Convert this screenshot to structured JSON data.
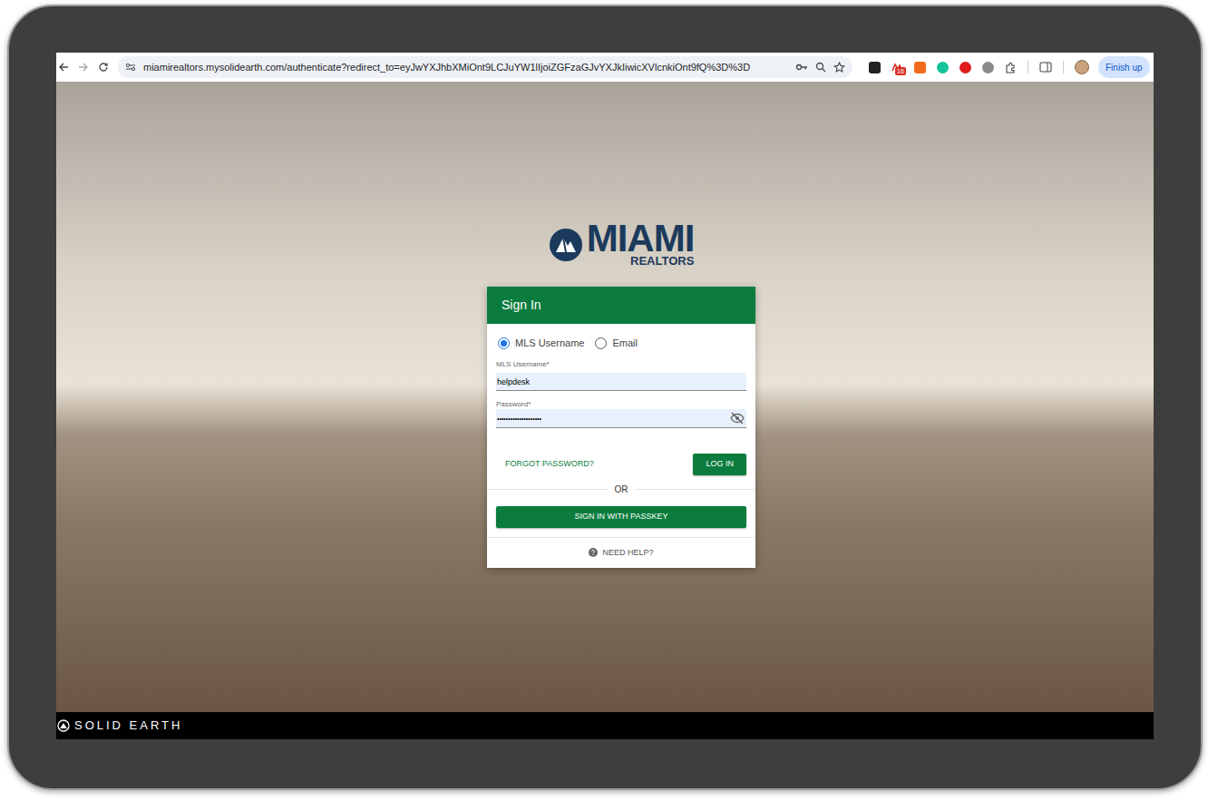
{
  "browser": {
    "url": "miamirealtors.mysolidearth.com/authenticate?redirect_to=eyJwYXJhbXMiOnt9LCJuYW1lIjoiZGFzaGJvYXJkIiwicXVlcnkiOnt9fQ%3D%3D",
    "badge": "16",
    "profile_button": "Finish up"
  },
  "logo": {
    "name": "MIAMI",
    "sub": "REALTORS"
  },
  "card": {
    "title": "Sign In",
    "login_methods": [
      {
        "label": "MLS Username",
        "selected": true
      },
      {
        "label": "Email",
        "selected": false
      }
    ],
    "fields": [
      {
        "label": "MLS Username*",
        "value": "helpdesk"
      },
      {
        "label": "Password*",
        "value": "••••••••••••••••••••"
      }
    ],
    "forgot": "FORGOT PASSWORD?",
    "login_button": "LOG IN",
    "divider": "OR",
    "passkey_button": "SIGN IN WITH PASSKEY",
    "help": "NEED HELP?"
  },
  "footer": {
    "brand": "SOLID EARTH"
  }
}
